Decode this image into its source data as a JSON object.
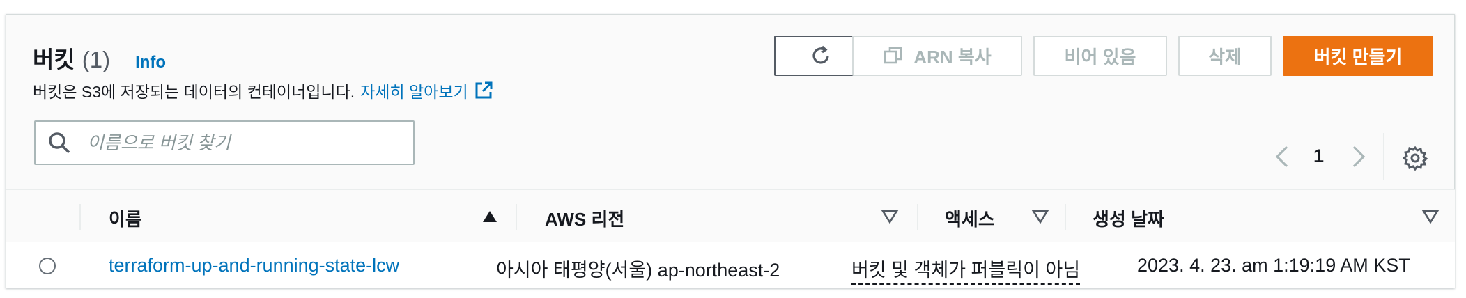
{
  "header": {
    "title": "버킷",
    "count": "(1)",
    "info_label": "Info",
    "description": "버킷은 S3에 저장되는 데이터의 컨테이너입니다.",
    "learn_more": "자세히 알아보기"
  },
  "actions": {
    "copy_arn": "ARN 복사",
    "empty": "비어 있음",
    "delete": "삭제",
    "create": "버킷 만들기"
  },
  "search": {
    "placeholder": "이름으로 버킷 찾기",
    "value": ""
  },
  "pagination": {
    "current_page": "1"
  },
  "table": {
    "columns": {
      "name": "이름",
      "region": "AWS 리전",
      "access": "액세스",
      "created": "생성 날짜"
    },
    "rows": [
      {
        "name": "terraform-up-and-running-state-lcw",
        "region": "아시아 태평양(서울) ap-northeast-2",
        "access": "버킷 및 객체가 퍼블릭이 아님",
        "created": "2023. 4. 23. am 1:19:19 AM KST"
      }
    ]
  },
  "colors": {
    "primary": "#ec7211",
    "link": "#0073bb",
    "disabled_text": "#aab7b8",
    "border": "#d5dbdb"
  },
  "icons": [
    "refresh-icon",
    "copy-icon",
    "external-link-icon",
    "search-icon",
    "chevron-left-icon",
    "chevron-right-icon",
    "settings-gear-icon",
    "sort-ascending-icon",
    "sort-descending-icon"
  ]
}
